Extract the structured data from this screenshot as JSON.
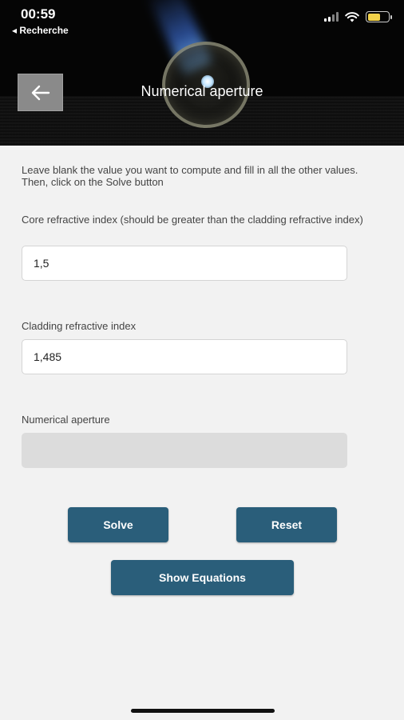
{
  "status_bar": {
    "time": "00:59",
    "back_app": "◂ Recherche"
  },
  "header": {
    "title": "Numerical aperture",
    "back_icon": "arrow-left-icon"
  },
  "instructions": "Leave blank the value you want to compute and fill in all the other values. Then, click on the Solve button",
  "fields": {
    "core": {
      "label": "Core refractive index (should be greater than the cladding refractive index)",
      "value": "1,5"
    },
    "cladding": {
      "label": "Cladding refractive index",
      "value": "1,485"
    },
    "aperture": {
      "label": "Numerical aperture",
      "value": ""
    }
  },
  "buttons": {
    "solve": "Solve",
    "reset": "Reset",
    "show_equations": "Show Equations"
  },
  "colors": {
    "button": "#2a5e7a",
    "background": "#f2f2f2",
    "header": "#050505"
  }
}
